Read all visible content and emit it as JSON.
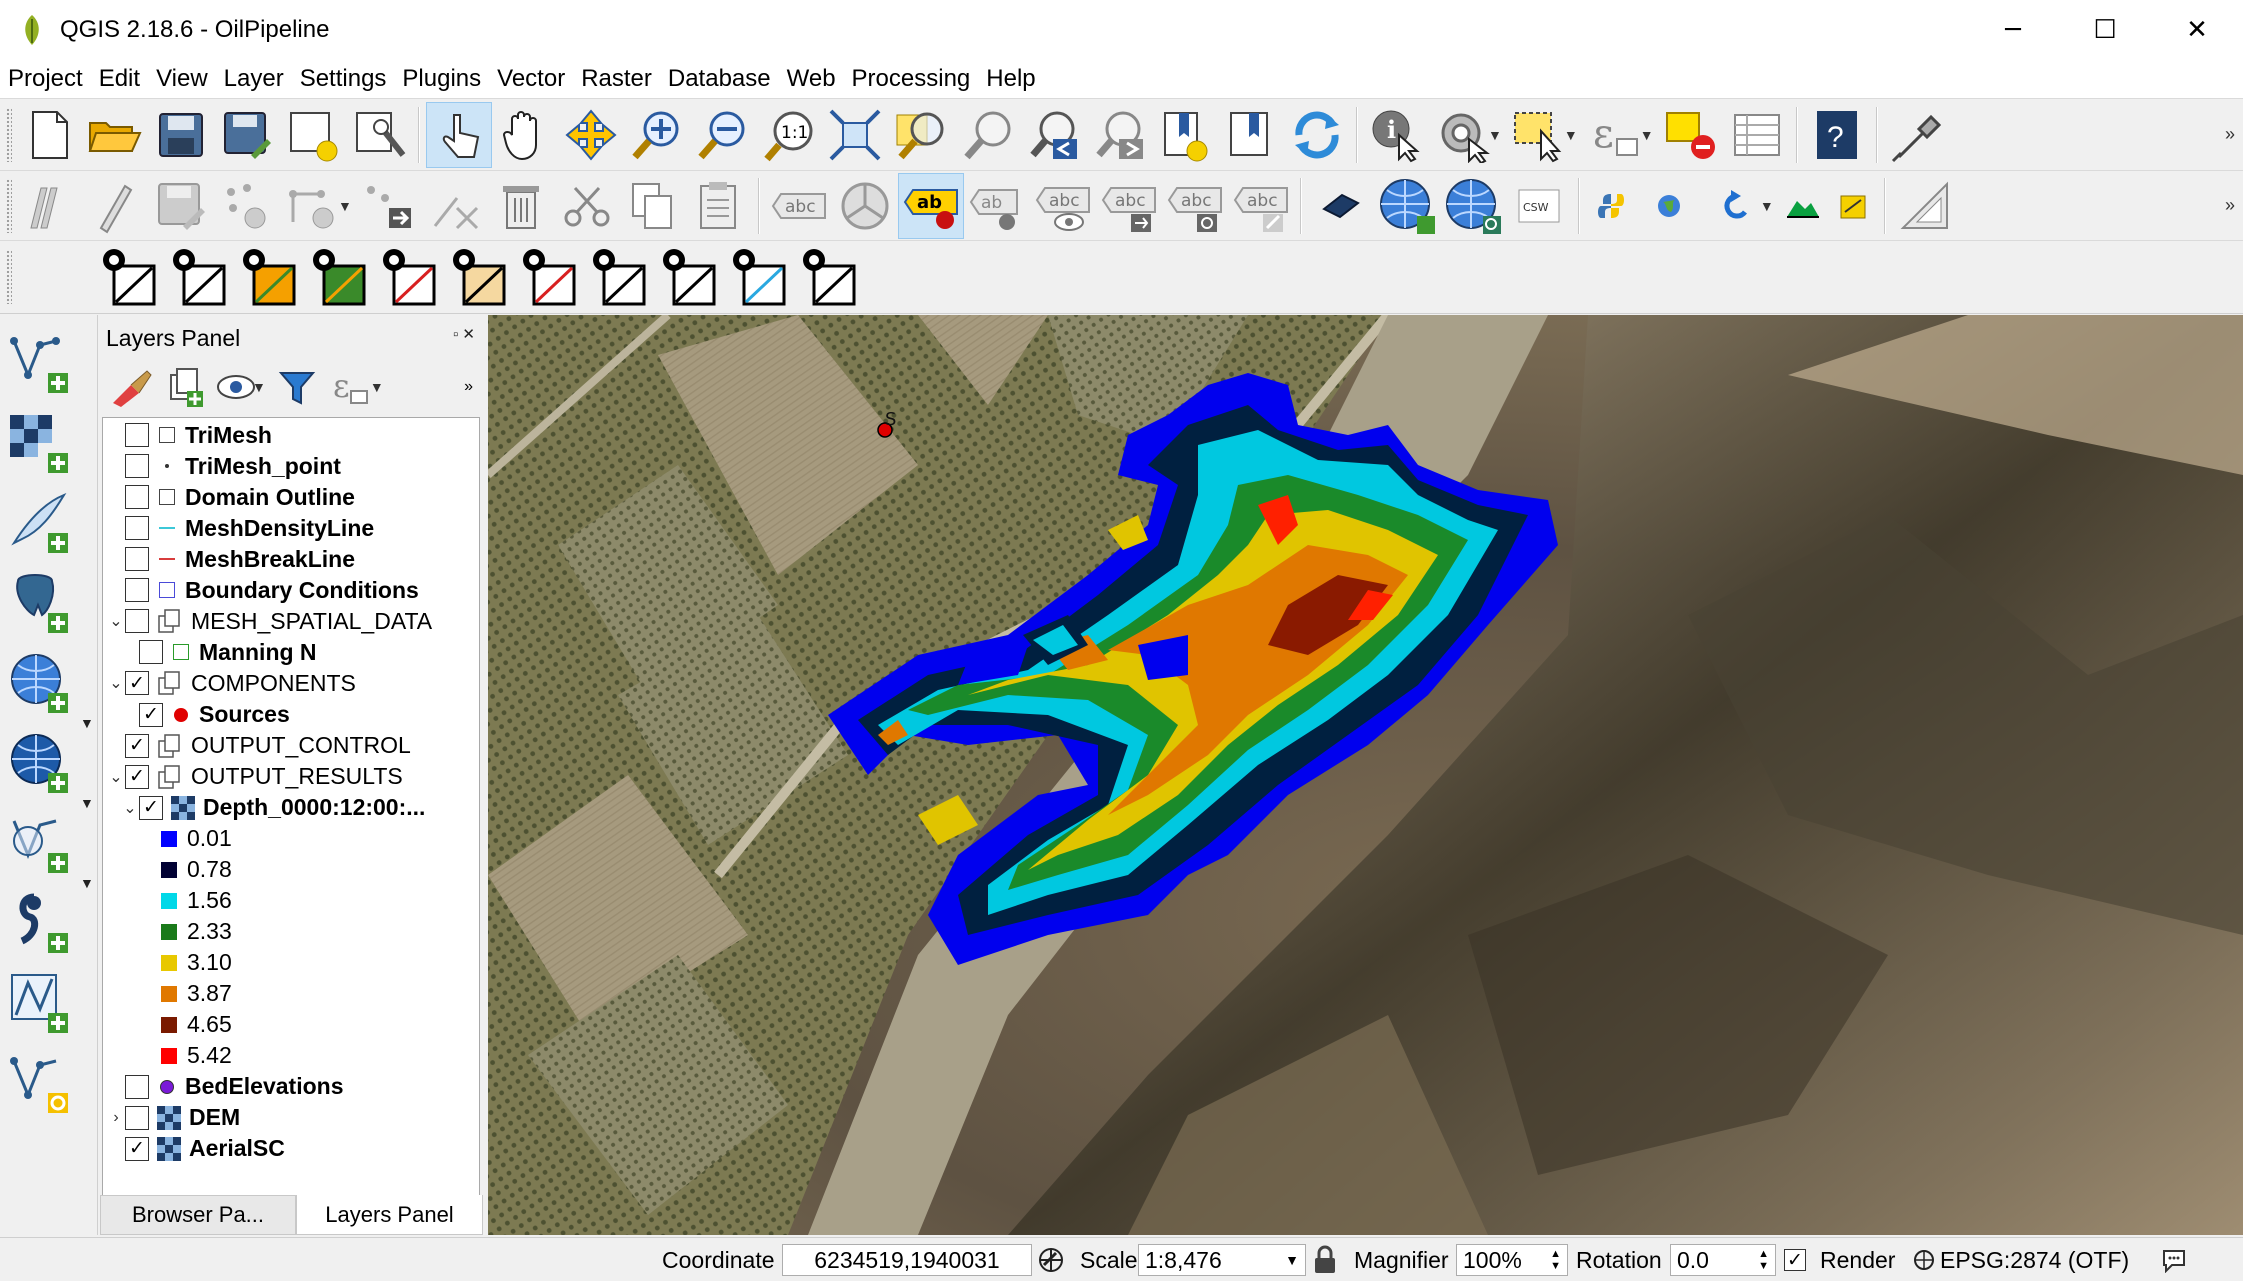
{
  "window": {
    "title": "QGIS 2.18.6 - OilPipeline",
    "minimize": "─",
    "maximize": "☐",
    "close": "✕"
  },
  "menu": [
    "Project",
    "Edit",
    "View",
    "Layer",
    "Settings",
    "Plugins",
    "Vector",
    "Raster",
    "Database",
    "Web",
    "Processing",
    "Help"
  ],
  "toolbar_icons": {
    "row1": [
      "new-project",
      "open-project",
      "save-project",
      "save-project-as",
      "new-print-composer",
      "composer-manager",
      "touch-zoom",
      "pan-map",
      "pan-to-selection",
      "zoom-in",
      "zoom-out",
      "zoom-native",
      "zoom-full",
      "zoom-to-selection",
      "zoom-to-layer",
      "zoom-last",
      "zoom-next",
      "new-bookmark",
      "show-bookmarks",
      "refresh",
      "identify-features",
      "run-feature-action",
      "select-features",
      "select-by-expression",
      "deselect-all",
      "open-attribute-table",
      "help"
    ],
    "row2": [
      "toggle-editing",
      "current-edits",
      "save-layer-edits",
      "add-feature",
      "vertex-tool",
      "move-feature",
      "node-tool",
      "delete-selected",
      "cut-features",
      "copy-features",
      "paste-features",
      "label-tool",
      "pin-labels",
      "highlight-labels",
      "move-label",
      "rotate-label",
      "change-label",
      "csw",
      "python-console",
      "georeferencer",
      "undo",
      "terrain",
      "sketch",
      "measure"
    ],
    "row3": [
      "model-component-1",
      "model-component-2",
      "model-component-3",
      "model-component-4",
      "model-component-5",
      "model-component-6",
      "model-component-7",
      "model-component-8",
      "model-component-9",
      "model-component-10",
      "model-component-11"
    ],
    "csw_label": "CSW",
    "abc_label": "abc",
    "ab_label": "ab",
    "help_label": "?",
    "one_to_one": "1:1"
  },
  "left_toolbar": [
    "add-vector-layer",
    "add-raster-layer",
    "add-delimited-text",
    "add-postgis-layer",
    "add-wms-layer",
    "add-wfs-layer",
    "add-spatialite-layer",
    "add-virtual-layer",
    "new-shapefile",
    "new-spatialite-layer"
  ],
  "layers_panel": {
    "title": "Layers Panel",
    "tab_browser": "Browser Pa...",
    "tab_layers": "Layers Panel",
    "layers": [
      {
        "name": "TriMesh",
        "checked": false,
        "bold": true,
        "indent": 0
      },
      {
        "name": "TriMesh_point",
        "checked": false,
        "bold": true,
        "indent": 0
      },
      {
        "name": "Domain Outline",
        "checked": false,
        "bold": true,
        "indent": 0
      },
      {
        "name": "MeshDensityLine",
        "checked": false,
        "bold": true,
        "indent": 0
      },
      {
        "name": "MeshBreakLine",
        "checked": false,
        "bold": true,
        "indent": 0
      },
      {
        "name": "Boundary Conditions",
        "checked": false,
        "bold": true,
        "indent": 0
      },
      {
        "name": "MESH_SPATIAL_DATA",
        "checked": false,
        "bold": false,
        "indent": 0
      },
      {
        "name": "Manning N",
        "checked": false,
        "bold": true,
        "indent": 1
      },
      {
        "name": "COMPONENTS",
        "checked": true,
        "bold": false,
        "indent": 0
      },
      {
        "name": "Sources",
        "checked": true,
        "bold": true,
        "indent": 1
      },
      {
        "name": "OUTPUT_CONTROL",
        "checked": true,
        "bold": false,
        "indent": 0
      },
      {
        "name": "OUTPUT_RESULTS",
        "checked": true,
        "bold": false,
        "indent": 0
      },
      {
        "name": "Depth_0000:12:00:...",
        "checked": true,
        "bold": true,
        "indent": 1
      },
      {
        "name": "BedElevations",
        "checked": false,
        "bold": true,
        "indent": 0
      },
      {
        "name": "DEM",
        "checked": false,
        "bold": true,
        "indent": 0
      },
      {
        "name": "AerialSC",
        "checked": true,
        "bold": true,
        "indent": 0
      }
    ],
    "legend": [
      {
        "value": "0.01",
        "color": "#0000ff"
      },
      {
        "value": "0.78",
        "color": "#000033"
      },
      {
        "value": "1.56",
        "color": "#00d8e8"
      },
      {
        "value": "2.33",
        "color": "#1a7a1a"
      },
      {
        "value": "3.10",
        "color": "#e8c800"
      },
      {
        "value": "3.87",
        "color": "#e07800"
      },
      {
        "value": "4.65",
        "color": "#7a1a00"
      },
      {
        "value": "5.42",
        "color": "#ff0000"
      }
    ]
  },
  "map": {
    "source_label": "S"
  },
  "statusbar": {
    "coordinate_label": "Coordinate",
    "coordinate_value": "6234519,1940031",
    "scale_label": "Scale",
    "scale_value": "1:8,476",
    "magnifier_label": "Magnifier",
    "magnifier_value": "100%",
    "rotation_label": "Rotation",
    "rotation_value": "0.0",
    "render_label": "Render",
    "render_checked": true,
    "crs_label": "EPSG:2874 (OTF)"
  }
}
